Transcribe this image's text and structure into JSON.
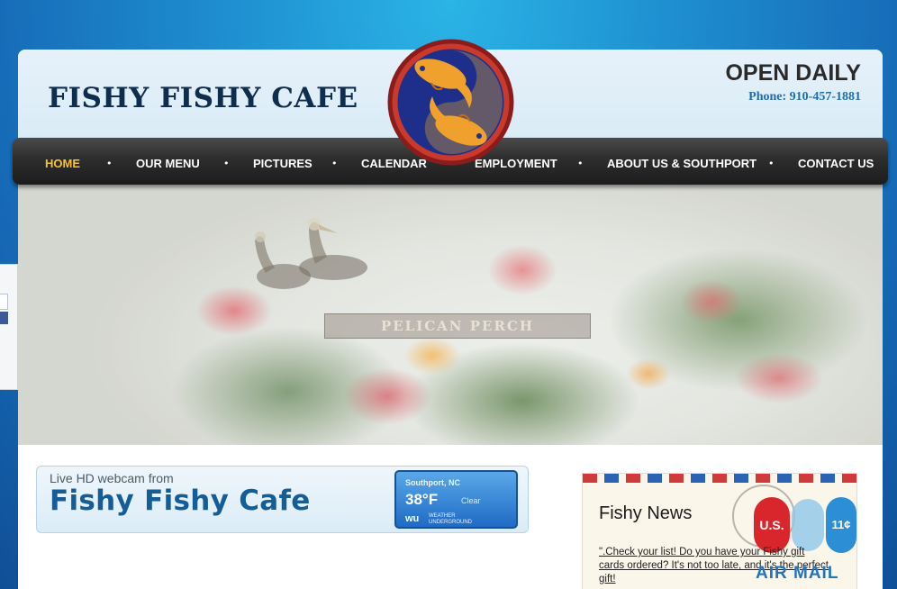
{
  "header": {
    "brand": "FISHY FISHY CAFE",
    "hours": "OPEN DAILY",
    "phone": "Phone: 910-457-1881"
  },
  "nav": {
    "items": [
      {
        "label": "HOME",
        "active": true
      },
      {
        "label": "OUR MENU",
        "active": false
      },
      {
        "label": "PICTURES",
        "active": false
      },
      {
        "label": "CALENDAR",
        "active": false
      },
      {
        "label": "EMPLOYMENT",
        "active": false
      },
      {
        "label": "ABOUT US & SOUTHPORT",
        "active": false
      },
      {
        "label": "CONTACT US",
        "active": false
      }
    ],
    "separator": "•"
  },
  "hero": {
    "sign_text": "PELICAN PERCH"
  },
  "webcam": {
    "line1": "Live HD webcam from",
    "line2": "Fishy Fishy Cafe",
    "weather": {
      "location": "Southport, NC",
      "temperature": "38°F",
      "condition": "Clear",
      "provider_logo": "wu",
      "provider_text_1": "WEATHER",
      "provider_text_2": "UNDERGROUND"
    }
  },
  "news": {
    "title": "Fishy News",
    "link_text": "\".Check your list! Do you have your Fishy gift cards ordered? It's not too late, and it's the perfect gift!",
    "stamp_us": "U.S.",
    "stamp_value": "11¢",
    "airmail": "AIR MAIL"
  },
  "colors": {
    "background": "#1e8fd0",
    "header_bg": "#e2eff8",
    "brand_text": "#0f2d4d",
    "nav_bg": "#2d2d2d",
    "nav_active": "#f7c22c",
    "phone_text": "#1f6fb0",
    "webcam_title": "#155d96"
  },
  "icons": {
    "logo": "koi-fish-logo",
    "side_widget": "facebook-widget-tab"
  }
}
